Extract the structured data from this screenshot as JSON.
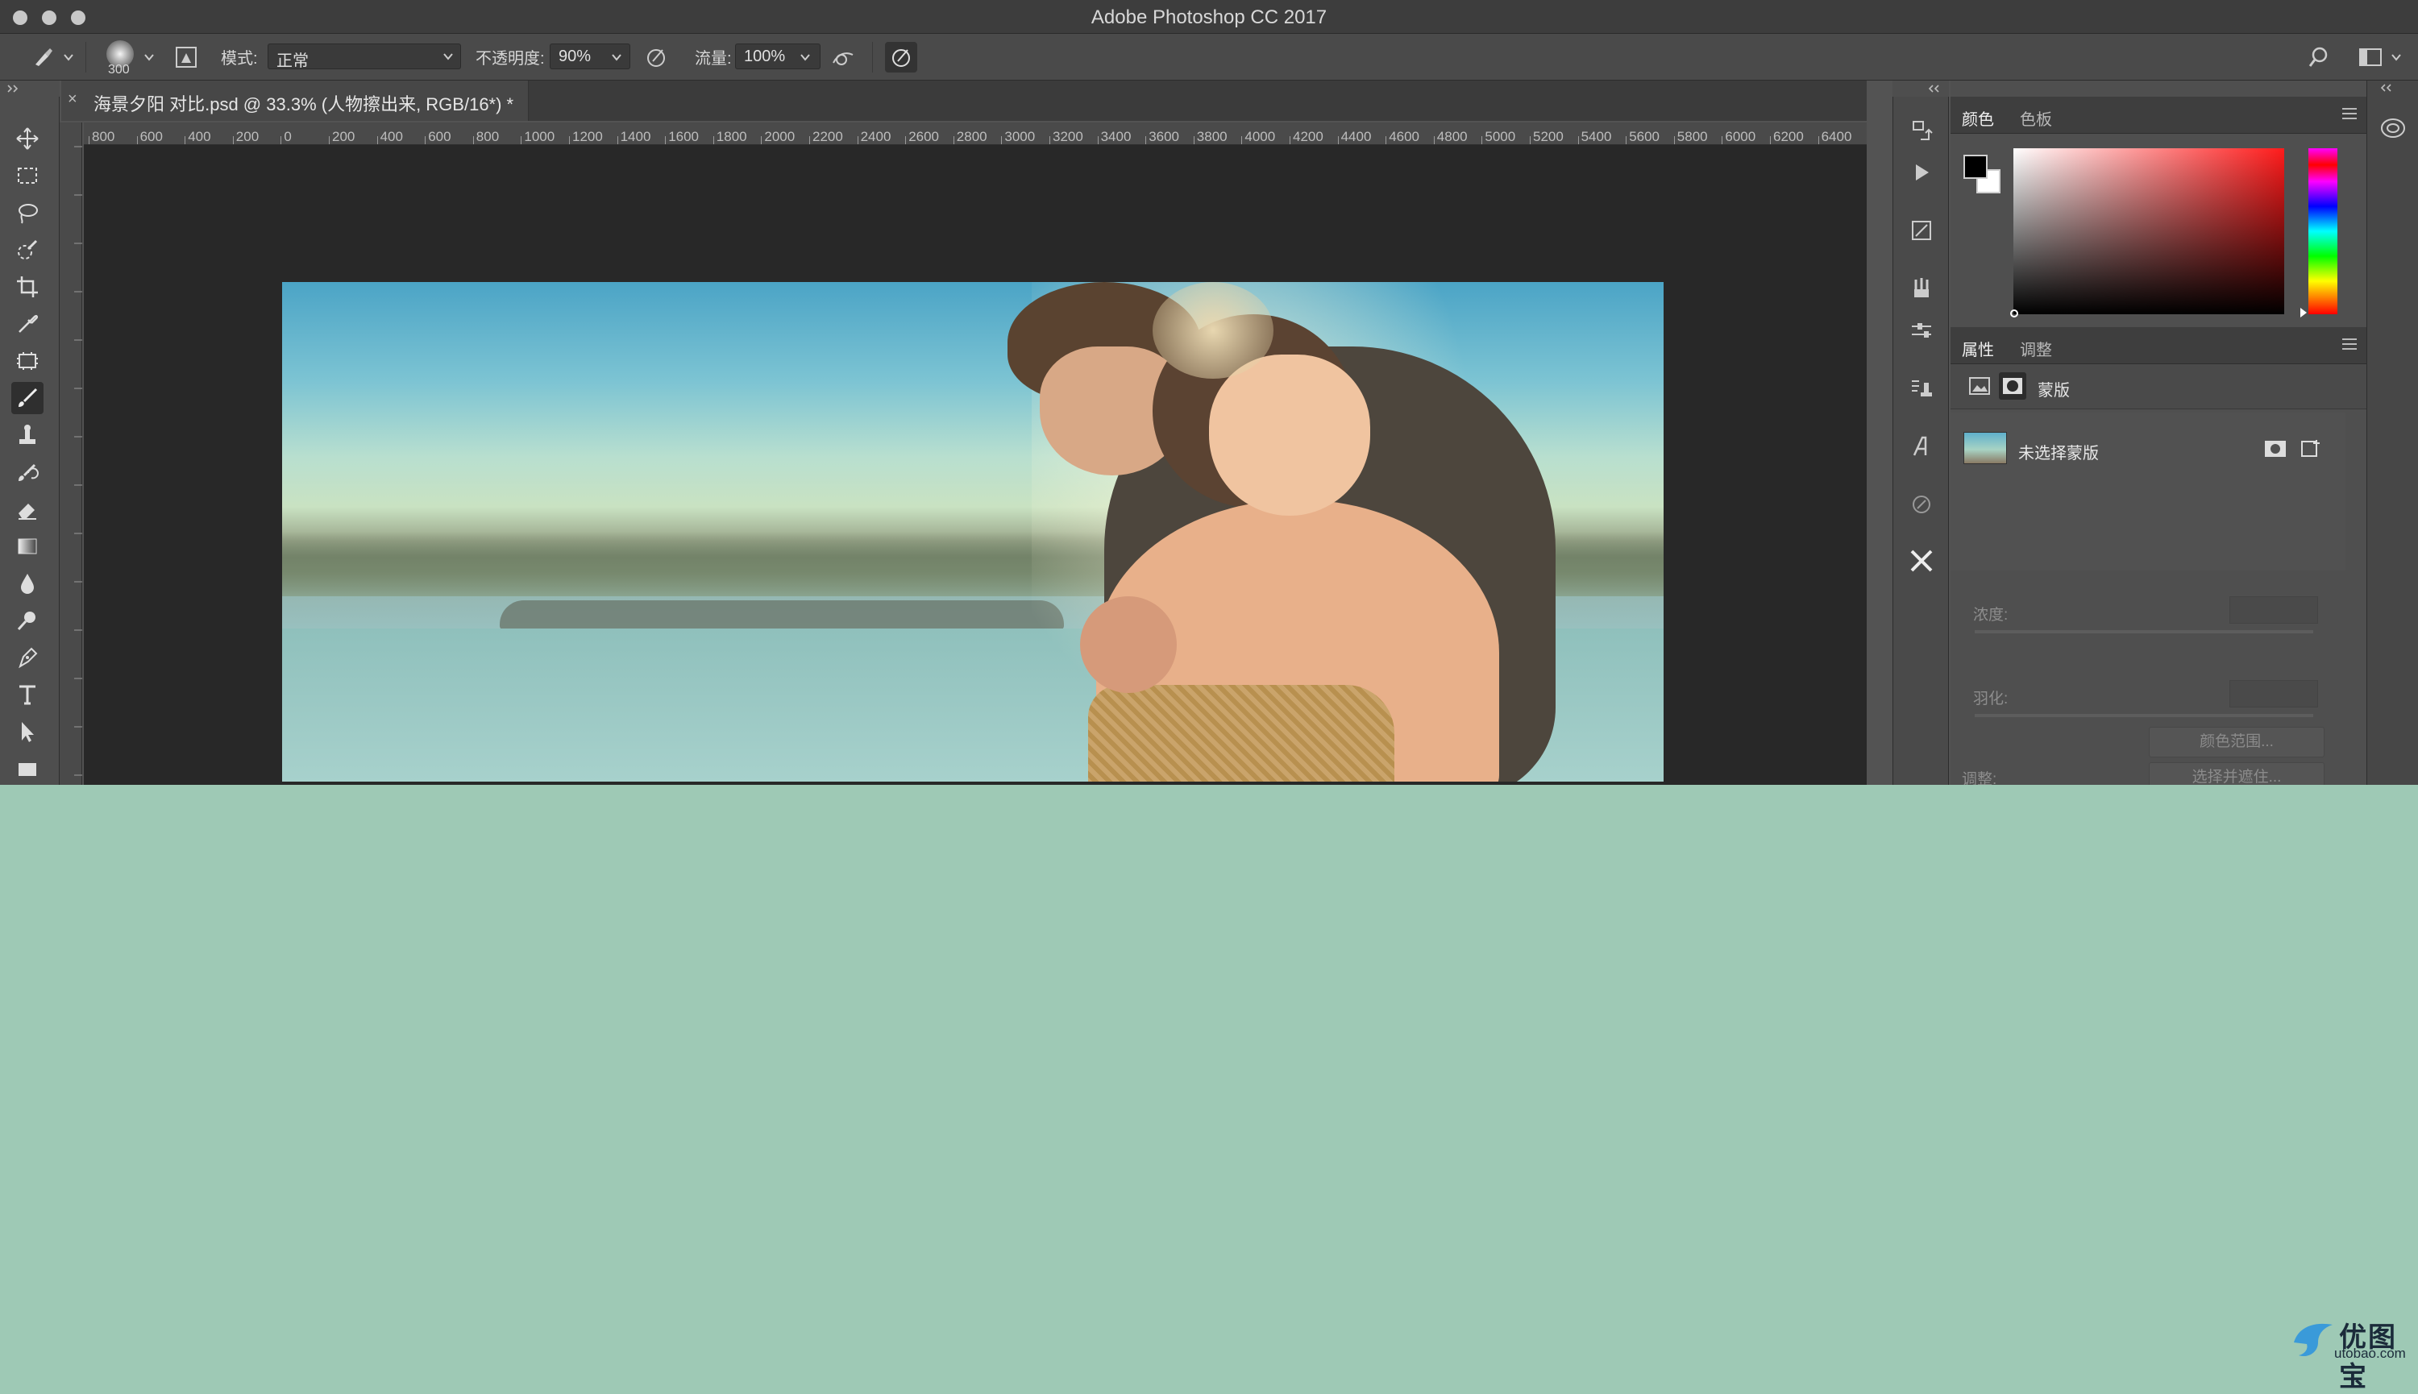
{
  "window": {
    "title": "Adobe Photoshop CC 2017"
  },
  "options_bar": {
    "brush_size": "300",
    "mode_label": "模式:",
    "mode_value": "正常",
    "opacity_label": "不透明度:",
    "opacity_value": "90%",
    "flow_label": "流量:",
    "flow_value": "100%"
  },
  "document": {
    "tab_title": "海景夕阳 对比.psd @ 33.3% (人物擦出来, RGB/16*) *",
    "close": "×"
  },
  "ruler": {
    "labels": [
      "800",
      "600",
      "400",
      "200",
      "0",
      "200",
      "400",
      "600",
      "800",
      "1000",
      "1200",
      "1400",
      "1600",
      "1800",
      "2000",
      "2200",
      "2400",
      "2600",
      "2800",
      "3000",
      "3200",
      "3400",
      "3600",
      "3800",
      "4000",
      "4200",
      "4400",
      "4600",
      "4800",
      "5000",
      "5200",
      "5400",
      "5600",
      "5800",
      "6000",
      "6200",
      "6400"
    ]
  },
  "color_panel": {
    "tabs": [
      "颜色",
      "色板"
    ],
    "foreground": "#000000",
    "background": "#ffffff",
    "hue": "#ff1b1b"
  },
  "properties_panel": {
    "tabs": [
      "属性",
      "调整"
    ],
    "section_label": "蒙版",
    "layer_text": "未选择蒙版",
    "density_label": "浓度:",
    "feather_label": "羽化:",
    "refine_label": "调整:",
    "select_mask_button": "选择并遮住...",
    "color_range_button": "颜色范围..."
  },
  "watermark": {
    "name": "优图宝",
    "url": "utobao.com"
  }
}
